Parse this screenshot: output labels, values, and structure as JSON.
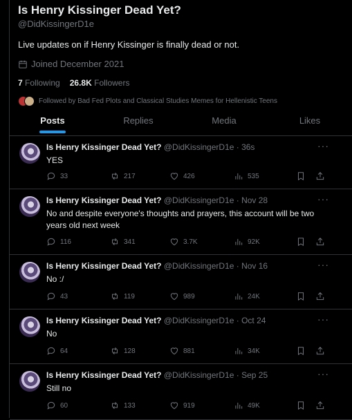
{
  "profile": {
    "name": "Is Henry Kissinger Dead Yet?",
    "handle": "@DidKissingerD1e",
    "bio": "Live updates on if Henry Kissinger is finally dead or not.",
    "joined": "Joined December 2021",
    "following_count": "7",
    "following_label": "Following",
    "followers_count": "26.8K",
    "followers_label": "Followers",
    "followed_by": "Followed by Bad Fed Plots and Classical Studies Memes for Hellenistic Teens"
  },
  "tabs": [
    {
      "label": "Posts",
      "active": true
    },
    {
      "label": "Replies",
      "active": false
    },
    {
      "label": "Media",
      "active": false
    },
    {
      "label": "Likes",
      "active": false
    }
  ],
  "tweets": [
    {
      "name": "Is Henry Kissinger Dead Yet?",
      "meta": "@DidKissingerD1e · 36s",
      "text": "YES",
      "replies": "33",
      "reposts": "217",
      "likes": "426",
      "views": "535"
    },
    {
      "name": "Is Henry Kissinger Dead Yet?",
      "meta": "@DidKissingerD1e · Nov 28",
      "text": "No and despite everyone's thoughts and prayers, this account will be two years old next week",
      "replies": "116",
      "reposts": "341",
      "likes": "3.7K",
      "views": "92K"
    },
    {
      "name": "Is Henry Kissinger Dead Yet?",
      "meta": "@DidKissingerD1e · Nov 16",
      "text": "No :/",
      "replies": "43",
      "reposts": "119",
      "likes": "989",
      "views": "24K"
    },
    {
      "name": "Is Henry Kissinger Dead Yet?",
      "meta": "@DidKissingerD1e · Oct 24",
      "text": "No",
      "replies": "64",
      "reposts": "128",
      "likes": "881",
      "views": "34K"
    },
    {
      "name": "Is Henry Kissinger Dead Yet?",
      "meta": "@DidKissingerD1e · Sep 25",
      "text": "Still no",
      "replies": "60",
      "reposts": "133",
      "likes": "919",
      "views": "49K"
    }
  ],
  "colors": {
    "accent": "#1d9bf0",
    "muted": "#71767b",
    "border": "#2f3336",
    "background": "#000000"
  }
}
